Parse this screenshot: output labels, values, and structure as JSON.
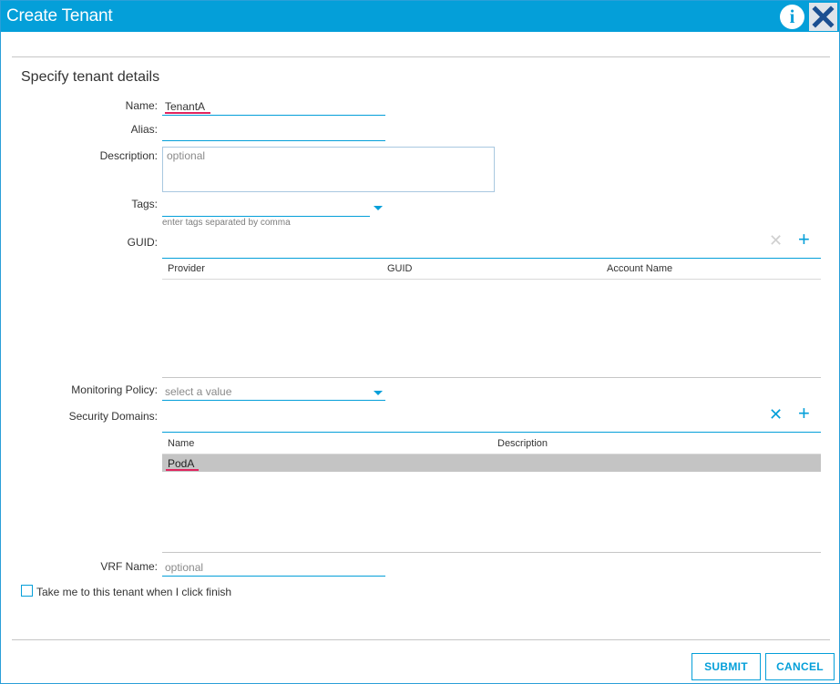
{
  "window": {
    "title": "Create Tenant"
  },
  "header_icons": {
    "info": "info-icon",
    "close": "close-icon"
  },
  "section_title": "Specify tenant details",
  "form": {
    "name": {
      "label": "Name:",
      "value": "TenantA"
    },
    "alias": {
      "label": "Alias:",
      "value": ""
    },
    "description": {
      "label": "Description:",
      "placeholder": "optional"
    },
    "tags": {
      "label": "Tags:",
      "value": "",
      "hint": "enter tags separated by comma"
    },
    "guid": {
      "label": "GUID:",
      "columns": [
        "Provider",
        "GUID",
        "Account Name"
      ],
      "rows": []
    },
    "monitoring_policy": {
      "label": "Monitoring Policy:",
      "value": "select a value"
    },
    "security_domains": {
      "label": "Security Domains:",
      "columns": [
        "Name",
        "Description"
      ],
      "rows": [
        {
          "name": "PodA",
          "description": ""
        }
      ]
    },
    "vrf_name": {
      "label": "VRF Name:",
      "placeholder": "optional"
    },
    "take_me": {
      "label": "Take me to this tenant when I click finish",
      "checked": false
    }
  },
  "buttons": {
    "submit": "SUBMIT",
    "cancel": "CANCEL"
  },
  "colors": {
    "accent": "#049fd9",
    "annotation": "#e0245e",
    "selected_row": "#c4c4c4"
  },
  "icons": {
    "delete": "delete-x-icon",
    "add": "plus-icon",
    "dropdown": "chevron-down-icon"
  }
}
